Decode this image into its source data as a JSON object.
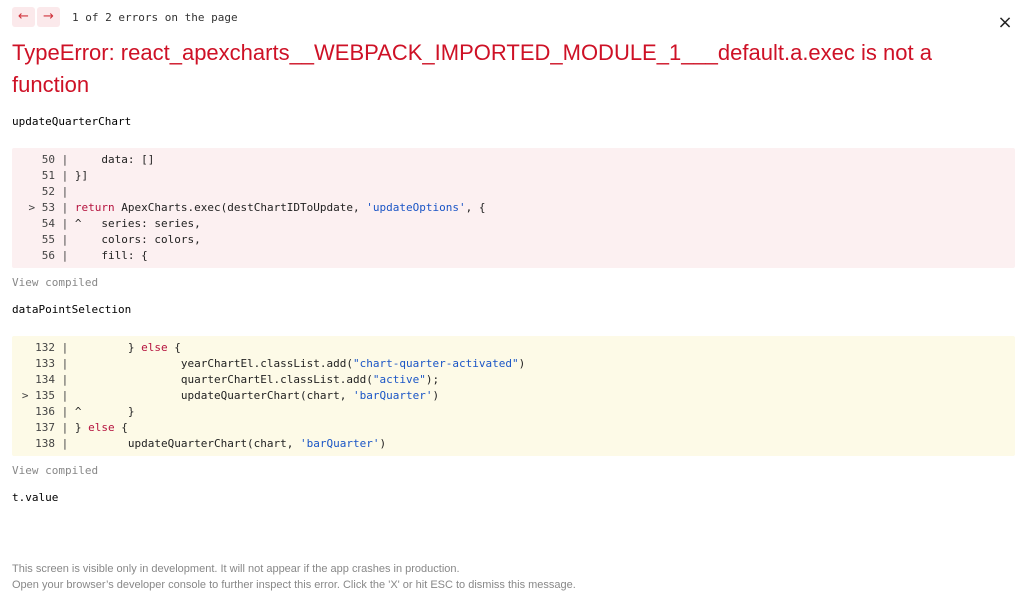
{
  "nav": {
    "prev_label": "←",
    "next_label": "→",
    "counter": "1 of 2 errors on the page"
  },
  "close_label": "×",
  "error": {
    "title": "TypeError: react_apexcharts__WEBPACK_IMPORTED_MODULE_1___default.a.exec is not a function"
  },
  "frames": [
    {
      "function": "updateQuarterChart",
      "view_compiled": "View compiled",
      "lines": [
        {
          "marker": "  ",
          "num": "50",
          "sep": " | ",
          "tokens": [
            {
              "t": "    data: []",
              "c": "cont"
            }
          ]
        },
        {
          "marker": "  ",
          "num": "51",
          "sep": " | ",
          "tokens": [
            {
              "t": "}]",
              "c": "cont"
            }
          ]
        },
        {
          "marker": "  ",
          "num": "52",
          "sep": " | ",
          "tokens": []
        },
        {
          "marker": "> ",
          "num": "53",
          "sep": " | ",
          "tokens": [
            {
              "t": "return",
              "c": "kw"
            },
            {
              "t": " ApexCharts.exec(destChartIDToUpdate, ",
              "c": "cont"
            },
            {
              "t": "'updateOptions'",
              "c": "str"
            },
            {
              "t": ", {",
              "c": "cont"
            }
          ]
        },
        {
          "marker": "  ",
          "num": "54",
          "sep": " | ",
          "tokens": [
            {
              "t": "^   series: series,",
              "c": "cont"
            }
          ]
        },
        {
          "marker": "  ",
          "num": "55",
          "sep": " | ",
          "tokens": [
            {
              "t": "    colors: colors,",
              "c": "cont"
            }
          ]
        },
        {
          "marker": "  ",
          "num": "56",
          "sep": " | ",
          "tokens": [
            {
              "t": "    fill: {",
              "c": "cont"
            }
          ]
        }
      ]
    },
    {
      "function": "dataPointSelection",
      "view_compiled": "View compiled",
      "lines": [
        {
          "marker": "  ",
          "num": "132",
          "sep": " | ",
          "tokens": [
            {
              "t": "        } ",
              "c": "cont"
            },
            {
              "t": "else",
              "c": "kw"
            },
            {
              "t": " {",
              "c": "cont"
            }
          ]
        },
        {
          "marker": "  ",
          "num": "133",
          "sep": " | ",
          "tokens": [
            {
              "t": "                yearChartEl.classList.add(",
              "c": "cont"
            },
            {
              "t": "\"chart-quarter-activated\"",
              "c": "str"
            },
            {
              "t": ")",
              "c": "cont"
            }
          ]
        },
        {
          "marker": "  ",
          "num": "134",
          "sep": " | ",
          "tokens": [
            {
              "t": "                quarterChartEl.classList.add(",
              "c": "cont"
            },
            {
              "t": "\"active\"",
              "c": "str"
            },
            {
              "t": ");",
              "c": "cont"
            }
          ]
        },
        {
          "marker": "> ",
          "num": "135",
          "sep": " | ",
          "tokens": [
            {
              "t": "                updateQuarterChart(chart, ",
              "c": "cont"
            },
            {
              "t": "'barQuarter'",
              "c": "str"
            },
            {
              "t": ")",
              "c": "cont"
            }
          ]
        },
        {
          "marker": "  ",
          "num": "136",
          "sep": " | ",
          "tokens": [
            {
              "t": "^       }",
              "c": "cont"
            }
          ]
        },
        {
          "marker": "  ",
          "num": "137",
          "sep": " | ",
          "tokens": [
            {
              "t": "} ",
              "c": "cont"
            },
            {
              "t": "else",
              "c": "kw"
            },
            {
              "t": " {",
              "c": "cont"
            }
          ]
        },
        {
          "marker": "  ",
          "num": "138",
          "sep": " | ",
          "tokens": [
            {
              "t": "        updateQuarterChart(chart, ",
              "c": "cont"
            },
            {
              "t": "'barQuarter'",
              "c": "str"
            },
            {
              "t": ")",
              "c": "cont"
            }
          ]
        }
      ]
    }
  ],
  "last_frame": {
    "function": "t.value"
  },
  "footer": {
    "line1": "This screen is visible only in development. It will not appear if the app crashes in production.",
    "line2": "Open your browser’s developer console to further inspect this error.  Click the 'X' or hit ESC to dismiss this message."
  }
}
